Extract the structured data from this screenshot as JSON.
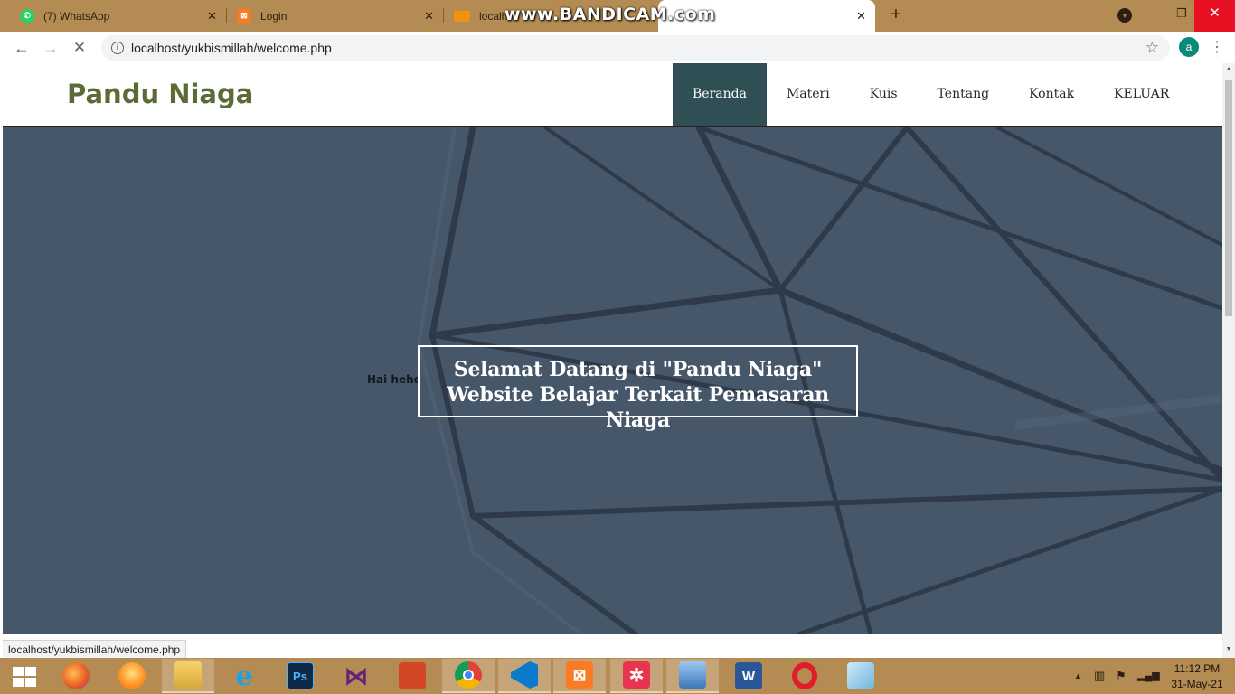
{
  "browser": {
    "tabs": [
      {
        "title": "(7) WhatsApp",
        "icon": "whatsapp-icon",
        "color": "#25d366"
      },
      {
        "title": "Login",
        "icon": "xampp-icon",
        "color": "#fb7a24"
      },
      {
        "title": "localh",
        "icon": "phpmyadmin-icon",
        "color": "#f29111"
      }
    ],
    "watermark": "www.BANDICAM.com",
    "url": "localhost/yukbismillah/welcome.php",
    "profile_initial": "a"
  },
  "site": {
    "brand": "Pandu Niaga",
    "nav": [
      "Beranda",
      "Materi",
      "Kuis",
      "Tentang",
      "Kontak",
      "KELUAR"
    ],
    "active_nav": "Beranda",
    "greeting": "Hai hehe",
    "welcome_line1": "Selamat Datang di \"Pandu Niaga\"",
    "welcome_line2": "Website Belajar Terkait Pemasaran Niaga",
    "colors": {
      "brand": "#5a6b35",
      "nav_active": "#2f4f55",
      "hero": "#46576a"
    }
  },
  "status_bar": "localhost/yukbismillah/welcome.php",
  "taskbar": {
    "apps": [
      "file-explorer-icon",
      "firefox-icon",
      "firefox-orange-icon",
      "explorer-folder-icon",
      "internet-explorer-icon",
      "photoshop-icon",
      "visual-studio-icon",
      "powerpoint-icon",
      "chrome-icon",
      "vscode-icon",
      "xampp-icon",
      "kodular-icon",
      "remote-desktop-icon",
      "word-icon",
      "opera-icon",
      "notepad-icon"
    ],
    "photoshop_label": "Ps",
    "word_label": "W",
    "time": "11:12 PM",
    "date": "31-May-21"
  }
}
